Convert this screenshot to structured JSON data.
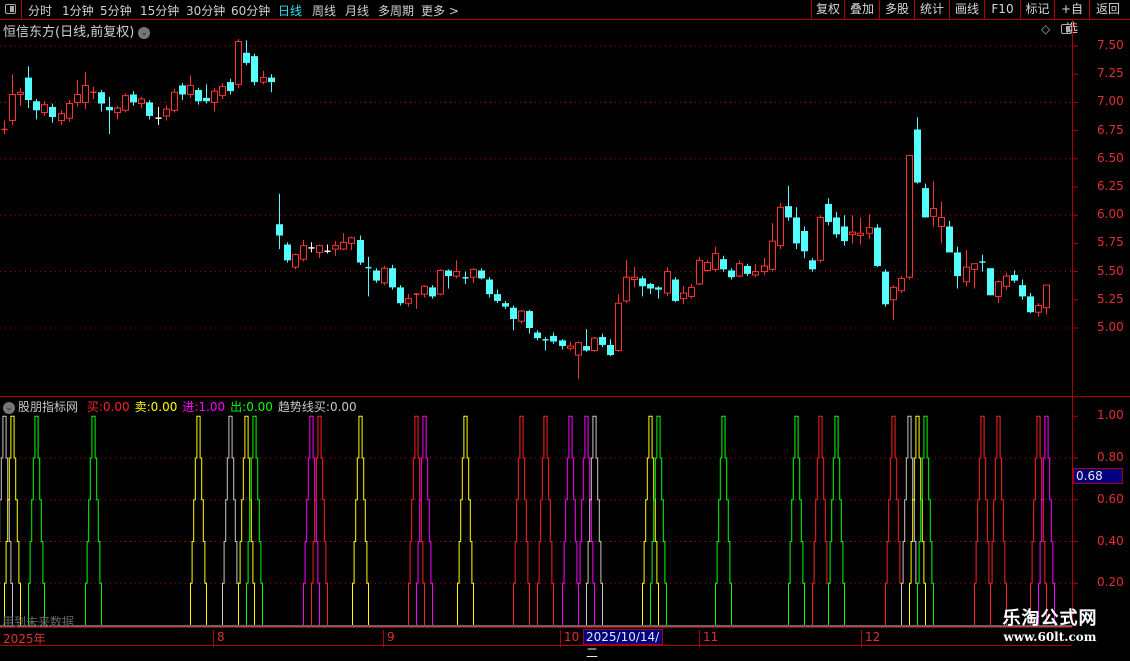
{
  "toolbar": {
    "tabs": [
      "分时",
      "1分钟",
      "5分钟",
      "15分钟",
      "30分钟",
      "60分钟",
      "日线",
      "周线",
      "月线",
      "多周期",
      "更多 >"
    ],
    "active_tab": "日线",
    "right_buttons": [
      "复权",
      "叠加",
      "多股",
      "统计",
      "画线",
      "F10",
      "标记",
      "+自选",
      "返回"
    ]
  },
  "chart": {
    "title": "恒信东方(日线,前复权)",
    "up_color": "#ff3232",
    "down_color": "#54ffff",
    "grid_color": "#b00000"
  },
  "price_axis": [
    "7.50",
    "7.25",
    "7.00",
    "6.75",
    "6.50",
    "6.25",
    "6.00",
    "5.75",
    "5.50",
    "5.25",
    "5.00"
  ],
  "indicator": {
    "name": "股朋指标网",
    "items": [
      {
        "label": "买:",
        "value": "0.00",
        "color": "#ff2020"
      },
      {
        "label": "卖:",
        "value": "0.00",
        "color": "#ffff00"
      },
      {
        "label": "进:",
        "value": "1.00",
        "color": "#ff00ff"
      },
      {
        "label": "出:",
        "value": "0.00",
        "color": "#00ff00"
      },
      {
        "label": "趋势线买:",
        "value": "0.00",
        "color": "#c8c8c8"
      }
    ],
    "axis": [
      "1.00",
      "0.80",
      "0.60",
      "0.40",
      "0.20"
    ],
    "current_value": "0.68",
    "watermark": "用到未来数据"
  },
  "time_axis": {
    "labels": [
      "2025年",
      "8",
      "9",
      "10",
      "11",
      "12"
    ],
    "cursor_date": "2025/10/14/二"
  },
  "logo": {
    "name": "乐淘公式网",
    "url": "www.60lt.com"
  },
  "chart_data": {
    "type": "candlestick",
    "ylim": [
      4.5,
      7.6
    ],
    "ohlc": [
      [
        6.755,
        6.84,
        6.72,
        6.76
      ],
      [
        6.84,
        7.25,
        6.8,
        7.07
      ],
      [
        7.07,
        7.13,
        6.97,
        7.09
      ],
      [
        7.22,
        7.32,
        6.95,
        7.02
      ],
      [
        7.01,
        7.03,
        6.85,
        6.93
      ],
      [
        6.91,
        7.01,
        6.88,
        6.98
      ],
      [
        6.96,
        6.99,
        6.82,
        6.87
      ],
      [
        6.84,
        6.93,
        6.8,
        6.9
      ],
      [
        6.86,
        7.02,
        6.83,
        6.99
      ],
      [
        7.0,
        7.2,
        6.96,
        7.07
      ],
      [
        7.0,
        7.27,
        6.94,
        7.15
      ],
      [
        7.085,
        7.14,
        7.03,
        7.09
      ],
      [
        7.09,
        7.11,
        6.92,
        6.99
      ],
      [
        6.96,
        7.05,
        6.72,
        6.93
      ],
      [
        6.91,
        6.97,
        6.85,
        6.95
      ],
      [
        6.93,
        7.08,
        6.91,
        7.06
      ],
      [
        7.07,
        7.1,
        6.97,
        7.0
      ],
      [
        6.99,
        7.05,
        6.95,
        7.03
      ],
      [
        7.0,
        7.02,
        6.85,
        6.88
      ],
      [
        6.86,
        6.96,
        6.8,
        6.86
      ],
      [
        6.88,
        6.97,
        6.84,
        6.94
      ],
      [
        6.93,
        7.12,
        6.91,
        7.09
      ],
      [
        7.15,
        7.17,
        7.02,
        7.07
      ],
      [
        7.07,
        7.24,
        7.04,
        7.15
      ],
      [
        7.11,
        7.13,
        6.98,
        7.01
      ],
      [
        7.04,
        7.16,
        6.99,
        7.01
      ],
      [
        7.0,
        7.13,
        6.92,
        7.1
      ],
      [
        7.06,
        7.17,
        7.03,
        7.14
      ],
      [
        7.18,
        7.21,
        7.07,
        7.1
      ],
      [
        7.16,
        7.56,
        7.13,
        7.54
      ],
      [
        7.44,
        7.55,
        7.33,
        7.35
      ],
      [
        7.41,
        7.43,
        7.15,
        7.18
      ],
      [
        7.18,
        7.28,
        7.16,
        7.22
      ],
      [
        7.22,
        7.25,
        7.09,
        7.18
      ],
      [
        5.92,
        6.19,
        5.7,
        5.82
      ],
      [
        5.74,
        5.76,
        5.58,
        5.6
      ],
      [
        5.54,
        5.66,
        5.52,
        5.65
      ],
      [
        5.61,
        5.78,
        5.59,
        5.73
      ],
      [
        5.71,
        5.76,
        5.67,
        5.71
      ],
      [
        5.67,
        5.74,
        5.62,
        5.73
      ],
      [
        5.68,
        5.74,
        5.66,
        5.68
      ],
      [
        5.7,
        5.77,
        5.64,
        5.73
      ],
      [
        5.7,
        5.84,
        5.69,
        5.76
      ],
      [
        5.75,
        5.81,
        5.69,
        5.8
      ],
      [
        5.78,
        5.82,
        5.56,
        5.58
      ],
      [
        5.535,
        5.63,
        5.28,
        5.53
      ],
      [
        5.51,
        5.53,
        5.4,
        5.42
      ],
      [
        5.4,
        5.55,
        5.38,
        5.53
      ],
      [
        5.53,
        5.56,
        5.34,
        5.36
      ],
      [
        5.36,
        5.38,
        5.2,
        5.22
      ],
      [
        5.22,
        5.3,
        5.19,
        5.26
      ],
      [
        5.295,
        5.31,
        5.17,
        5.3
      ],
      [
        5.3,
        5.38,
        5.27,
        5.37
      ],
      [
        5.36,
        5.38,
        5.26,
        5.28
      ],
      [
        5.3,
        5.52,
        5.29,
        5.51
      ],
      [
        5.51,
        5.52,
        5.35,
        5.46
      ],
      [
        5.46,
        5.6,
        5.44,
        5.5
      ],
      [
        5.445,
        5.5,
        5.39,
        5.44
      ],
      [
        5.45,
        5.53,
        5.4,
        5.52
      ],
      [
        5.51,
        5.53,
        5.43,
        5.44
      ],
      [
        5.43,
        5.45,
        5.27,
        5.3
      ],
      [
        5.3,
        5.34,
        5.22,
        5.24
      ],
      [
        5.22,
        5.24,
        5.17,
        5.19
      ],
      [
        5.18,
        5.2,
        4.98,
        5.08
      ],
      [
        5.06,
        5.16,
        5.04,
        5.15
      ],
      [
        5.15,
        5.16,
        4.95,
        5.0
      ],
      [
        4.96,
        4.98,
        4.89,
        4.91
      ],
      [
        4.895,
        4.92,
        4.8,
        4.89
      ],
      [
        4.93,
        4.96,
        4.86,
        4.88
      ],
      [
        4.89,
        4.9,
        4.81,
        4.84
      ],
      [
        4.82,
        4.88,
        4.8,
        4.84
      ],
      [
        4.76,
        4.88,
        4.55,
        4.87
      ],
      [
        4.84,
        4.99,
        4.79,
        4.8
      ],
      [
        4.8,
        4.92,
        4.79,
        4.91
      ],
      [
        4.92,
        4.95,
        4.83,
        4.85
      ],
      [
        4.85,
        4.9,
        4.75,
        4.76
      ],
      [
        4.8,
        5.3,
        4.79,
        5.22
      ],
      [
        5.24,
        5.6,
        5.22,
        5.45
      ],
      [
        5.43,
        5.54,
        5.36,
        5.45
      ],
      [
        5.44,
        5.46,
        5.28,
        5.37
      ],
      [
        5.39,
        5.4,
        5.3,
        5.35
      ],
      [
        5.36,
        5.37,
        5.26,
        5.34
      ],
      [
        5.31,
        5.54,
        5.28,
        5.5
      ],
      [
        5.43,
        5.45,
        5.23,
        5.24
      ],
      [
        5.26,
        5.37,
        5.21,
        5.31
      ],
      [
        5.28,
        5.39,
        5.26,
        5.36
      ],
      [
        5.39,
        5.63,
        5.38,
        5.6
      ],
      [
        5.51,
        5.6,
        5.5,
        5.58
      ],
      [
        5.52,
        5.72,
        5.5,
        5.66
      ],
      [
        5.61,
        5.64,
        5.5,
        5.52
      ],
      [
        5.51,
        5.53,
        5.43,
        5.45
      ],
      [
        5.46,
        5.6,
        5.45,
        5.57
      ],
      [
        5.55,
        5.57,
        5.46,
        5.48
      ],
      [
        5.47,
        5.57,
        5.45,
        5.5
      ],
      [
        5.5,
        5.62,
        5.47,
        5.55
      ],
      [
        5.52,
        5.93,
        5.5,
        5.77
      ],
      [
        5.73,
        6.11,
        5.7,
        6.07
      ],
      [
        6.08,
        6.26,
        5.95,
        5.98
      ],
      [
        5.98,
        6.07,
        5.7,
        5.75
      ],
      [
        5.86,
        5.9,
        5.62,
        5.68
      ],
      [
        5.6,
        5.62,
        5.5,
        5.52
      ],
      [
        5.6,
        6.0,
        5.58,
        5.98
      ],
      [
        6.1,
        6.15,
        5.91,
        5.94
      ],
      [
        5.98,
        6.03,
        5.8,
        5.83
      ],
      [
        5.9,
        6.0,
        5.73,
        5.77
      ],
      [
        5.83,
        6.0,
        5.75,
        5.85
      ],
      [
        5.82,
        5.98,
        5.74,
        5.84
      ],
      [
        5.84,
        6.01,
        5.79,
        5.89
      ],
      [
        5.89,
        5.92,
        5.54,
        5.55
      ],
      [
        5.5,
        5.52,
        5.19,
        5.21
      ],
      [
        5.25,
        5.38,
        5.07,
        5.36
      ],
      [
        5.33,
        5.46,
        5.31,
        5.44
      ],
      [
        5.45,
        6.53,
        5.43,
        6.53
      ],
      [
        6.76,
        6.87,
        6.28,
        6.29
      ],
      [
        6.24,
        6.28,
        5.98,
        5.98
      ],
      [
        5.99,
        6.3,
        5.9,
        6.06
      ],
      [
        5.9,
        6.12,
        5.75,
        5.98
      ],
      [
        5.9,
        5.95,
        5.67,
        5.67
      ],
      [
        5.67,
        5.72,
        5.35,
        5.46
      ],
      [
        5.41,
        5.69,
        5.37,
        5.54
      ],
      [
        5.52,
        5.57,
        5.35,
        5.57
      ],
      [
        5.585,
        5.65,
        5.5,
        5.58
      ],
      [
        5.53,
        5.53,
        5.29,
        5.29
      ],
      [
        5.28,
        5.42,
        5.22,
        5.41
      ],
      [
        5.37,
        5.49,
        5.34,
        5.46
      ],
      [
        5.47,
        5.51,
        5.4,
        5.42
      ],
      [
        5.38,
        5.43,
        5.25,
        5.28
      ],
      [
        5.28,
        5.31,
        5.13,
        5.14
      ],
      [
        5.14,
        5.22,
        5.1,
        5.2
      ],
      [
        5.18,
        5.38,
        5.12,
        5.38
      ]
    ],
    "indicator_ylim": [
      0,
      1.05
    ],
    "signals": [
      [
        0,
        "#c8c8c8"
      ],
      [
        1,
        "#ffff00"
      ],
      [
        4,
        "#00ff00"
      ],
      [
        11,
        "#00ff00"
      ],
      [
        24,
        "#ffff00"
      ],
      [
        28,
        "#c8c8c8"
      ],
      [
        30,
        "#ffff00"
      ],
      [
        31,
        "#00ff00"
      ],
      [
        38,
        "#ff00ff"
      ],
      [
        39,
        "#ff2020"
      ],
      [
        44,
        "#ffff00"
      ],
      [
        51,
        "#ff2020"
      ],
      [
        52,
        "#ff00ff"
      ],
      [
        57,
        "#ffff00"
      ],
      [
        64,
        "#ff2020"
      ],
      [
        67,
        "#ff2020"
      ],
      [
        70,
        "#ff00ff"
      ],
      [
        72,
        "#ff00ff"
      ],
      [
        73,
        "#c8c8c8"
      ],
      [
        80,
        "#ffff00"
      ],
      [
        81,
        "#00ff00"
      ],
      [
        89,
        "#00ff00"
      ],
      [
        98,
        "#00ff00"
      ],
      [
        101,
        "#ff2020"
      ],
      [
        103,
        "#00ff00"
      ],
      [
        110,
        "#ff2020"
      ],
      [
        112,
        "#c8c8c8"
      ],
      [
        113,
        "#ffff00"
      ],
      [
        114,
        "#00ff00"
      ],
      [
        121,
        "#ff2020"
      ],
      [
        123,
        "#ff2020"
      ],
      [
        128,
        "#ff2020"
      ],
      [
        129,
        "#ff00ff"
      ]
    ]
  }
}
